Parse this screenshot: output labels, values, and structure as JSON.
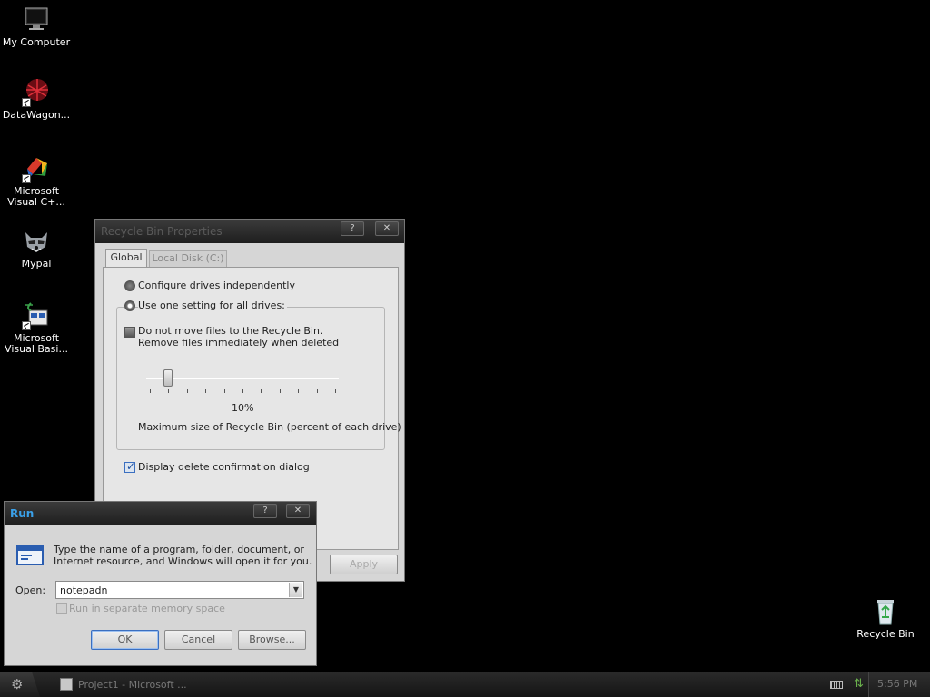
{
  "desktop": {
    "icons": [
      {
        "label": "My Computer"
      },
      {
        "label": "DataWagon..."
      },
      {
        "label": "Microsoft Visual C+..."
      },
      {
        "label": "Mypal"
      },
      {
        "label": "Microsoft Visual Basi..."
      },
      {
        "label": "Recycle Bin"
      }
    ]
  },
  "recycle_props": {
    "title": "Recycle Bin Properties",
    "tabs": [
      {
        "label": "Global"
      },
      {
        "label": "Local Disk (C:)"
      }
    ],
    "radio_independent": "Configure drives independently",
    "radio_one_setting": "Use one setting for all drives:",
    "no_move_line1": "Do not move files to the Recycle Bin.",
    "no_move_line2": "Remove files immediately when deleted",
    "slider_value": "10%",
    "slider_fraction": 0.1,
    "slider_caption": "Maximum size of Recycle Bin (percent of each drive)",
    "display_confirm": "Display delete confirmation dialog",
    "apply_label": "Apply",
    "help_glyph": "?",
    "close_glyph": "✕"
  },
  "run_dialog": {
    "title": "Run",
    "description_line1": "Type the name of a program, folder, document, or",
    "description_line2": "Internet resource, and Windows will open it for you.",
    "open_label": "Open:",
    "open_value": "notepadn",
    "separate_memory": "Run in separate memory space",
    "ok_label": "OK",
    "cancel_label": "Cancel",
    "browse_label": "Browse...",
    "help_glyph": "?",
    "close_glyph": "✕"
  },
  "taskbar": {
    "task_label": "Project1 - Microsoft ...",
    "clock": "5:56 PM"
  },
  "colors": {
    "desktop": "#000000",
    "window_face": "#d6d6d6",
    "active_title": "#3aa0e8",
    "titlebar": "#2a2a2a"
  }
}
